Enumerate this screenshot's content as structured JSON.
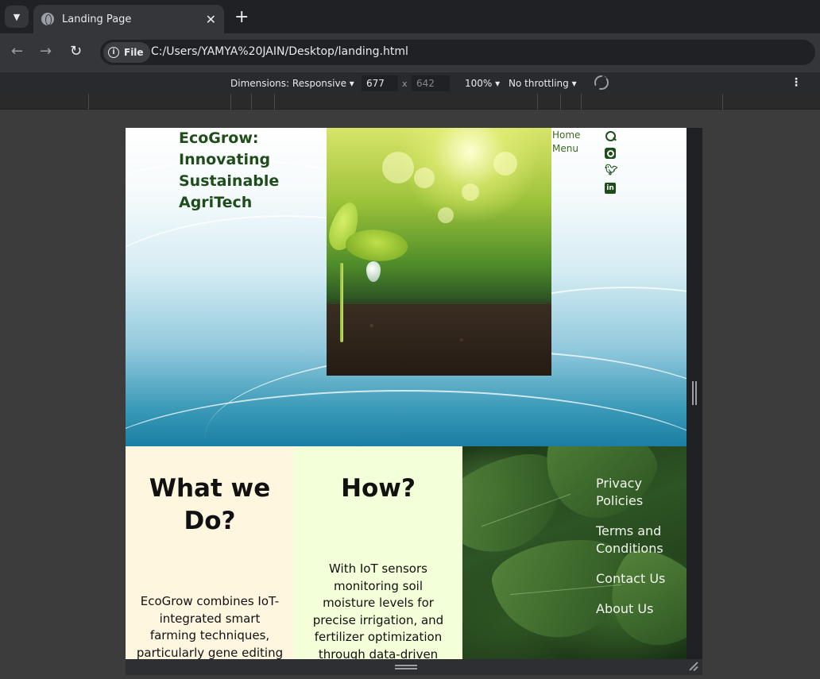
{
  "browser": {
    "tab_title": "Landing Page",
    "tab_close": "✕",
    "new_tab": "+",
    "file_chip": "File",
    "url": "C:/Users/YAMYA%20JAIN/Desktop/landing.html"
  },
  "devtools": {
    "dimensions": "Dimensions: Responsive ▾",
    "width": "677",
    "x": "x",
    "height": "642",
    "zoom": "100% ▾",
    "throttling": "No throttling ▾"
  },
  "hero": {
    "title": "EcoGrow: Innovating Sustainable AgriTech",
    "nav": [
      "Home",
      "Menu"
    ]
  },
  "sections": {
    "what": {
      "heading": "What we Do?",
      "body": "EcoGrow combines IoT-integrated smart farming techniques, particularly gene editing for sustainable"
    },
    "how": {
      "heading": "How?",
      "body": "With IoT sensors monitoring soil moisture levels for precise irrigation, and fertilizer optimization through data-driven decisions to minimize"
    }
  },
  "footer": {
    "links": [
      "Privacy Policies",
      "Terms and Conditions",
      "Contact Us",
      "About Us"
    ]
  },
  "icons": {
    "social": [
      "search-icon",
      "instagram-icon",
      "twitter-icon",
      "linkedin-icon"
    ]
  },
  "colors": {
    "brand_green": "#1f4d1a",
    "what_bg": "#fff6e0",
    "how_bg": "#f3ffd8"
  }
}
